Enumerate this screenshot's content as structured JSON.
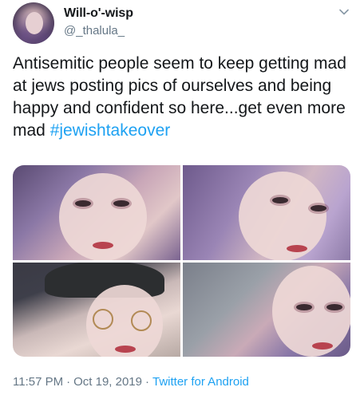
{
  "user": {
    "display_name": "Will-o'-wisp",
    "handle": "@_thalula_"
  },
  "icons": {
    "menu": "chevron-down-icon"
  },
  "tweet": {
    "text": "Antisemitic people seem to keep getting mad at jews posting pics of ourselves and being happy and confident so here...get even more mad ",
    "hashtag": "#jewishtakeover"
  },
  "media": {
    "count": 4
  },
  "meta": {
    "time": "11:57 PM",
    "sep1": "·",
    "date": "Oct 19, 2019",
    "sep2": "·",
    "source": "Twitter for Android"
  },
  "colors": {
    "text": "#14171a",
    "secondary": "#657786",
    "link": "#1da1f2"
  }
}
